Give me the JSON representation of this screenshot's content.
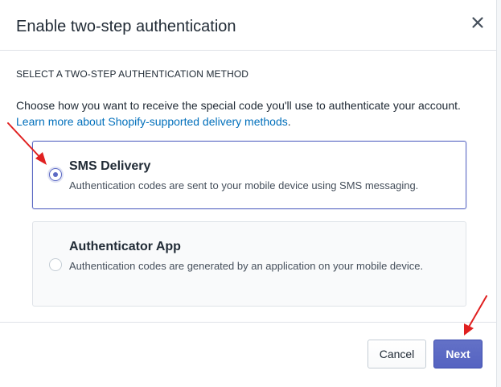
{
  "dialog": {
    "title": "Enable two-step authentication",
    "close_icon": "close-icon"
  },
  "method_section": {
    "heading": "SELECT A TWO-STEP AUTHENTICATION METHOD",
    "description": "Choose how you want to receive the special code you'll use to authenticate your account.",
    "learn_more_link": "Learn more about Shopify-supported delivery methods",
    "learn_more_suffix": "."
  },
  "options": [
    {
      "title": "SMS Delivery",
      "description": "Authentication codes are sent to your mobile device using SMS messaging.",
      "selected": true
    },
    {
      "title": "Authenticator App",
      "description": "Authentication codes are generated by an application on your mobile device.",
      "selected": false
    }
  ],
  "footer": {
    "cancel_label": "Cancel",
    "next_label": "Next"
  },
  "colors": {
    "accent": "#5c6ac4",
    "link": "#006fbb",
    "annotation_arrow": "#e02020"
  }
}
